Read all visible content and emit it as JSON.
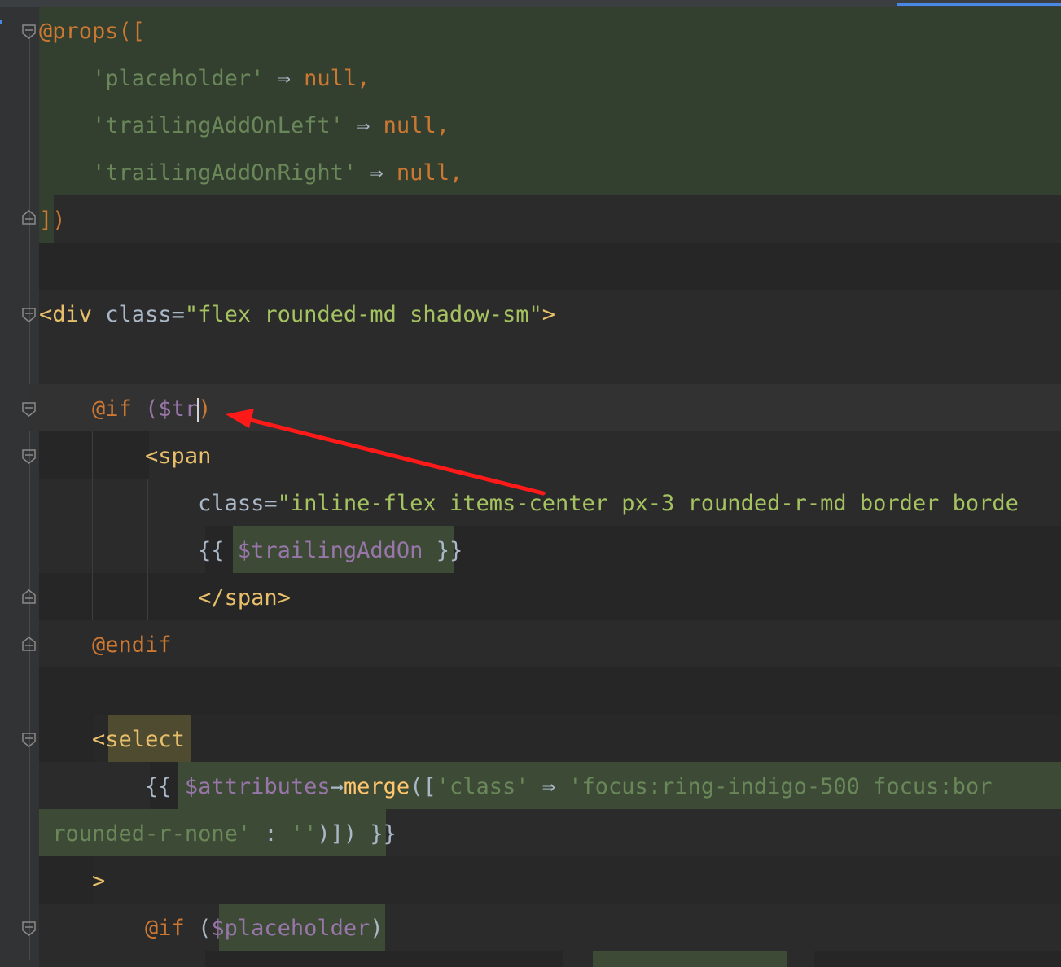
{
  "code": {
    "line1": {
      "kw": "@props",
      "open": "(["
    },
    "line2": {
      "key": "'placeholder'",
      "arrow": " ⇒ ",
      "val": "null",
      "comma": ","
    },
    "line3": {
      "key": "'trailingAddOnLeft'",
      "arrow": " ⇒ ",
      "val": "null",
      "comma": ","
    },
    "line4": {
      "key": "'trailingAddOnRight'",
      "arrow": " ⇒ ",
      "val": "null",
      "comma": ","
    },
    "line5": {
      "close": "])"
    },
    "line7": {
      "tag_open": "<div",
      "attr": " class=",
      "value": "\"flex rounded-md shadow-sm\"",
      "tag_close": ">"
    },
    "line9": {
      "kw": "@if",
      "paren": " ($tr",
      "caret_after": ")"
    },
    "line10": {
      "tag": "<span"
    },
    "line11": {
      "attr": "class=",
      "value": "\"inline-flex items-center px-3 rounded-r-md border borde"
    },
    "line12": {
      "open": "{{ ",
      "var": "$trailingAddOn",
      "close": " }}"
    },
    "line13": {
      "tag": "</span>"
    },
    "line14": {
      "kw": "@endif"
    },
    "line16": {
      "lt": "<",
      "tag": "select"
    },
    "line17": {
      "open": "{{ ",
      "var": "$attributes",
      "arrow": "→",
      "fn": "merge",
      "paren": "([",
      "key": "'class'",
      "farrow": " ⇒ ",
      "value": "'focus:ring-indigo-500 focus:bor"
    },
    "line18": {
      "value": "rounded-r-none'",
      "rest": " : ",
      "empty": "''",
      "close": ")]) }}"
    },
    "line19": {
      "gt": ">"
    },
    "line20": {
      "kw": "@if",
      "open": " (",
      "var": "$placeholder",
      "close": ")"
    }
  },
  "colors": {
    "background": "#2b2b2b",
    "keyword": "#cc7832",
    "string": "#6a8759",
    "variable": "#9876aa",
    "tag": "#e8bf6a",
    "annotation_arrow": "#ff0000"
  }
}
